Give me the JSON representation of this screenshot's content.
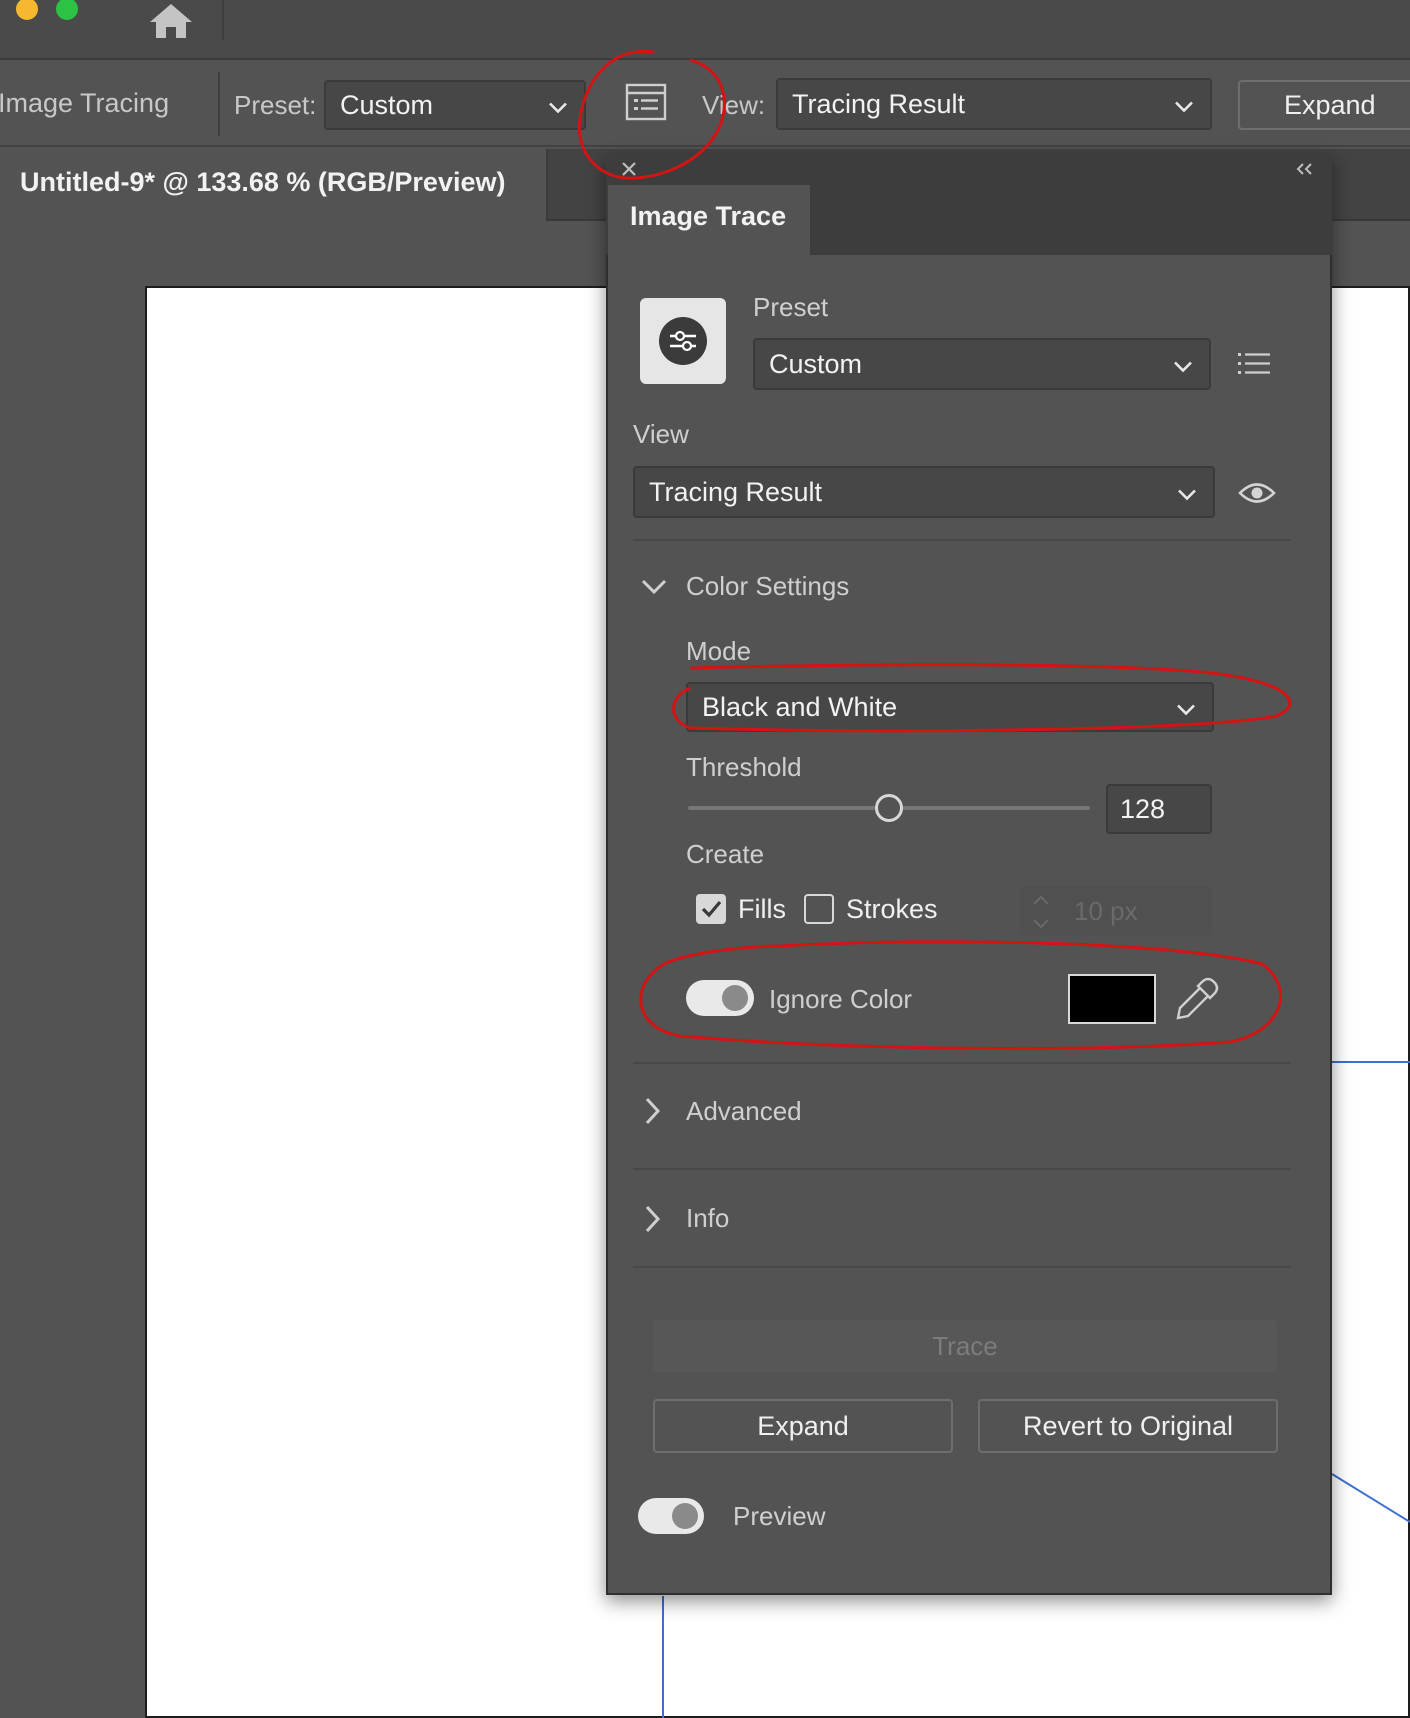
{
  "toolbar": {
    "tool_name": "Image Tracing",
    "preset_label": "Preset:",
    "preset_value": "Custom",
    "view_label": "View:",
    "view_value": "Tracing Result",
    "expand_label": "Expand"
  },
  "document": {
    "tab_title": "Untitled-9* @ 133.68 % (RGB/Preview)"
  },
  "panel": {
    "title": "Image Trace",
    "preset_label": "Preset",
    "preset_value": "Custom",
    "view_label": "View",
    "view_value": "Tracing Result",
    "color_settings_label": "Color Settings",
    "mode_label": "Mode",
    "mode_value": "Black and White",
    "threshold_label": "Threshold",
    "threshold_value": "128",
    "threshold_fraction": 0.5,
    "create_label": "Create",
    "fills_label": "Fills",
    "fills_checked": true,
    "strokes_label": "Strokes",
    "strokes_checked": false,
    "stroke_width_value": "10 px",
    "ignore_color_label": "Ignore Color",
    "ignore_color_on": true,
    "ignore_color_swatch": "#000000",
    "advanced_label": "Advanced",
    "info_label": "Info",
    "trace_label": "Trace",
    "expand_label": "Expand",
    "revert_label": "Revert to Original",
    "preview_label": "Preview",
    "preview_on": true
  },
  "icons": {
    "home": "home-icon",
    "panel_toggle": "panel-list-icon",
    "preset_options": "sliders-icon",
    "preset_menu": "list-menu-icon",
    "view_preview": "eye-icon",
    "eyedropper": "eyedropper-icon",
    "close": "close-icon",
    "collapse": "double-chevron-left-icon"
  },
  "colors": {
    "window_yellow": "#f5b82e",
    "window_green": "#2cc244",
    "annotation_red": "#d21414",
    "guide_blue": "#3d6fd1",
    "ui_background": "#535353"
  }
}
